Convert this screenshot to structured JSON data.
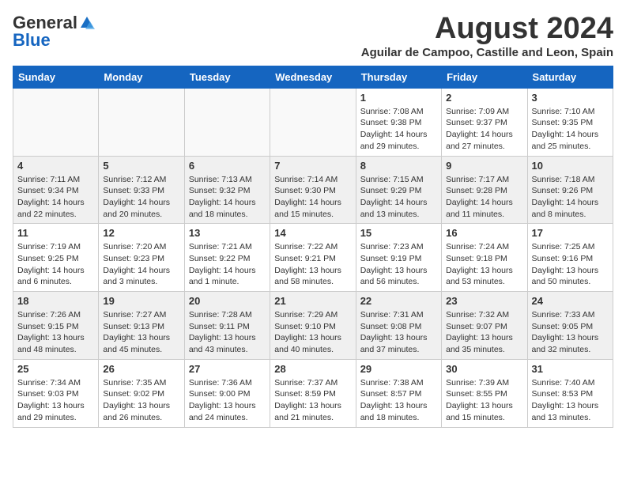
{
  "header": {
    "logo_general": "General",
    "logo_blue": "Blue",
    "month_year": "August 2024",
    "location": "Aguilar de Campoo, Castille and Leon, Spain"
  },
  "weekdays": [
    "Sunday",
    "Monday",
    "Tuesday",
    "Wednesday",
    "Thursday",
    "Friday",
    "Saturday"
  ],
  "weeks": [
    [
      {
        "num": "",
        "info": ""
      },
      {
        "num": "",
        "info": ""
      },
      {
        "num": "",
        "info": ""
      },
      {
        "num": "",
        "info": ""
      },
      {
        "num": "1",
        "info": "Sunrise: 7:08 AM\nSunset: 9:38 PM\nDaylight: 14 hours and 29 minutes."
      },
      {
        "num": "2",
        "info": "Sunrise: 7:09 AM\nSunset: 9:37 PM\nDaylight: 14 hours and 27 minutes."
      },
      {
        "num": "3",
        "info": "Sunrise: 7:10 AM\nSunset: 9:35 PM\nDaylight: 14 hours and 25 minutes."
      }
    ],
    [
      {
        "num": "4",
        "info": "Sunrise: 7:11 AM\nSunset: 9:34 PM\nDaylight: 14 hours and 22 minutes."
      },
      {
        "num": "5",
        "info": "Sunrise: 7:12 AM\nSunset: 9:33 PM\nDaylight: 14 hours and 20 minutes."
      },
      {
        "num": "6",
        "info": "Sunrise: 7:13 AM\nSunset: 9:32 PM\nDaylight: 14 hours and 18 minutes."
      },
      {
        "num": "7",
        "info": "Sunrise: 7:14 AM\nSunset: 9:30 PM\nDaylight: 14 hours and 15 minutes."
      },
      {
        "num": "8",
        "info": "Sunrise: 7:15 AM\nSunset: 9:29 PM\nDaylight: 14 hours and 13 minutes."
      },
      {
        "num": "9",
        "info": "Sunrise: 7:17 AM\nSunset: 9:28 PM\nDaylight: 14 hours and 11 minutes."
      },
      {
        "num": "10",
        "info": "Sunrise: 7:18 AM\nSunset: 9:26 PM\nDaylight: 14 hours and 8 minutes."
      }
    ],
    [
      {
        "num": "11",
        "info": "Sunrise: 7:19 AM\nSunset: 9:25 PM\nDaylight: 14 hours and 6 minutes."
      },
      {
        "num": "12",
        "info": "Sunrise: 7:20 AM\nSunset: 9:23 PM\nDaylight: 14 hours and 3 minutes."
      },
      {
        "num": "13",
        "info": "Sunrise: 7:21 AM\nSunset: 9:22 PM\nDaylight: 14 hours and 1 minute."
      },
      {
        "num": "14",
        "info": "Sunrise: 7:22 AM\nSunset: 9:21 PM\nDaylight: 13 hours and 58 minutes."
      },
      {
        "num": "15",
        "info": "Sunrise: 7:23 AM\nSunset: 9:19 PM\nDaylight: 13 hours and 56 minutes."
      },
      {
        "num": "16",
        "info": "Sunrise: 7:24 AM\nSunset: 9:18 PM\nDaylight: 13 hours and 53 minutes."
      },
      {
        "num": "17",
        "info": "Sunrise: 7:25 AM\nSunset: 9:16 PM\nDaylight: 13 hours and 50 minutes."
      }
    ],
    [
      {
        "num": "18",
        "info": "Sunrise: 7:26 AM\nSunset: 9:15 PM\nDaylight: 13 hours and 48 minutes."
      },
      {
        "num": "19",
        "info": "Sunrise: 7:27 AM\nSunset: 9:13 PM\nDaylight: 13 hours and 45 minutes."
      },
      {
        "num": "20",
        "info": "Sunrise: 7:28 AM\nSunset: 9:11 PM\nDaylight: 13 hours and 43 minutes."
      },
      {
        "num": "21",
        "info": "Sunrise: 7:29 AM\nSunset: 9:10 PM\nDaylight: 13 hours and 40 minutes."
      },
      {
        "num": "22",
        "info": "Sunrise: 7:31 AM\nSunset: 9:08 PM\nDaylight: 13 hours and 37 minutes."
      },
      {
        "num": "23",
        "info": "Sunrise: 7:32 AM\nSunset: 9:07 PM\nDaylight: 13 hours and 35 minutes."
      },
      {
        "num": "24",
        "info": "Sunrise: 7:33 AM\nSunset: 9:05 PM\nDaylight: 13 hours and 32 minutes."
      }
    ],
    [
      {
        "num": "25",
        "info": "Sunrise: 7:34 AM\nSunset: 9:03 PM\nDaylight: 13 hours and 29 minutes."
      },
      {
        "num": "26",
        "info": "Sunrise: 7:35 AM\nSunset: 9:02 PM\nDaylight: 13 hours and 26 minutes."
      },
      {
        "num": "27",
        "info": "Sunrise: 7:36 AM\nSunset: 9:00 PM\nDaylight: 13 hours and 24 minutes."
      },
      {
        "num": "28",
        "info": "Sunrise: 7:37 AM\nSunset: 8:59 PM\nDaylight: 13 hours and 21 minutes."
      },
      {
        "num": "29",
        "info": "Sunrise: 7:38 AM\nSunset: 8:57 PM\nDaylight: 13 hours and 18 minutes."
      },
      {
        "num": "30",
        "info": "Sunrise: 7:39 AM\nSunset: 8:55 PM\nDaylight: 13 hours and 15 minutes."
      },
      {
        "num": "31",
        "info": "Sunrise: 7:40 AM\nSunset: 8:53 PM\nDaylight: 13 hours and 13 minutes."
      }
    ]
  ]
}
